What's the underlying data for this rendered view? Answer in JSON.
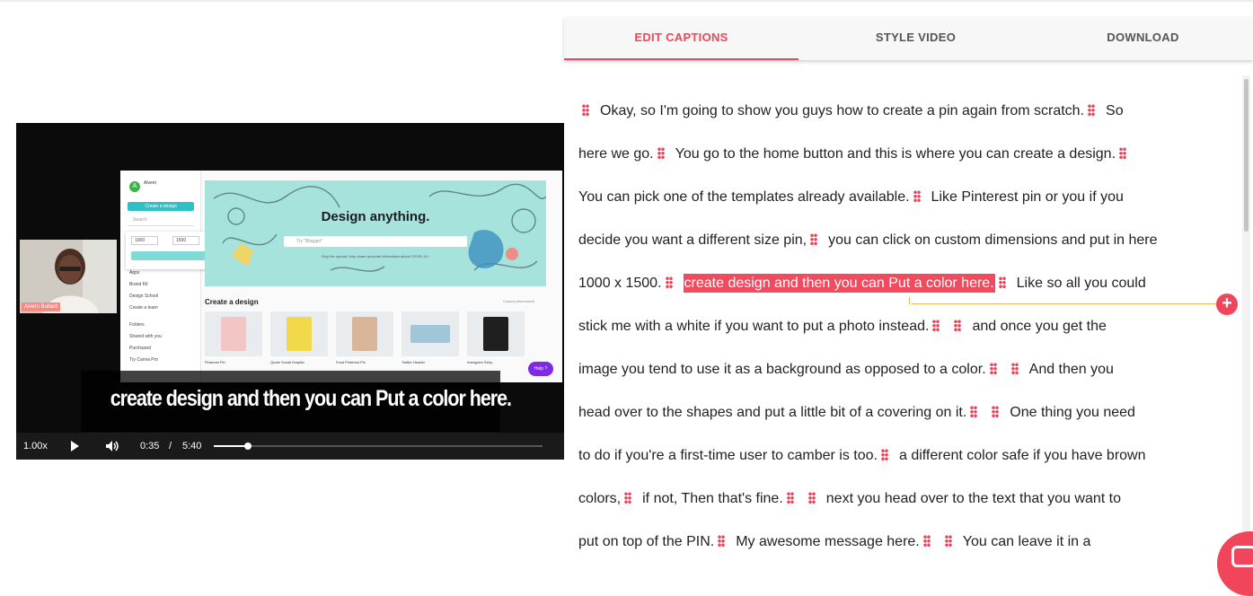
{
  "colors": {
    "accent": "#f0455a",
    "highlight": "#f04b5e",
    "insert_marker": "#f7b45a"
  },
  "tabs": [
    {
      "label": "EDIT CAPTIONS",
      "active": true
    },
    {
      "label": "STYLE VIDEO",
      "active": false
    },
    {
      "label": "DOWNLOAD",
      "active": false
    }
  ],
  "video": {
    "speed": "1.00x",
    "current_time": "0:35",
    "separator": "/",
    "duration": "5:40",
    "progress_fraction": 0.103,
    "caption": "create design and then you can Put a color here.",
    "webcam_name": "Alvern Bullard",
    "canva": {
      "user": "Alvern",
      "create_button": "Create a design",
      "search_placeholder": "Search",
      "width_value": "1000",
      "height_value": "1500",
      "unit": "px",
      "sidebar_items": [
        "Apps",
        "Brand Kit",
        "Design School",
        "Create a team",
        "Folders",
        "Shared with you",
        "Purchased",
        "Try Canva Pro"
      ],
      "banner_title": "Design anything.",
      "banner_search_placeholder": "Try \"Blogger\"",
      "banner_note": "Stop the spread. Help share accurate information about COVID-19 ›",
      "section_title": "Create a design",
      "custom_dimensions": "Custom dimensions",
      "templates": [
        "Pinterest Pin",
        "Quote Social Graphic",
        "Food Pinterest Pin",
        "Twitter Header",
        "Instagram Story"
      ],
      "help_label": "Help ?"
    }
  },
  "captions": [
    [
      {
        "text": "Okay, so I'm going to show you guys how to create a pin again from scratch."
      },
      {
        "text": "So"
      }
    ],
    [
      {
        "text": "here we go."
      },
      {
        "text": "You go to the home button and this is where you can create a design."
      },
      {
        "text": ""
      }
    ],
    [
      {
        "text": "You can pick one of the templates already available."
      },
      {
        "text": "Like Pinterest pin or you if you"
      }
    ],
    [
      {
        "text": "decide you want a different size pin,"
      },
      {
        "text": "you can click on custom dimensions and put in here"
      }
    ],
    [
      {
        "text": "1000 x 1500."
      },
      {
        "text": "create design and then you can Put a color here.",
        "highlighted": true
      },
      {
        "text": "Like so all you could"
      }
    ],
    [
      {
        "text": "stick me with a white if you want to put a photo instead."
      },
      {
        "text": ""
      },
      {
        "text": "and once you get the"
      }
    ],
    [
      {
        "text": "image you tend to use it as a background as opposed to a color."
      },
      {
        "text": ""
      },
      {
        "text": "And then you"
      }
    ],
    [
      {
        "text": "head over to the shapes and put a little bit of a covering on it."
      },
      {
        "text": ""
      },
      {
        "text": "One thing you need"
      }
    ],
    [
      {
        "text": "to do if you're a first-time user to camber is too."
      },
      {
        "text": "a different color safe if you have brown"
      }
    ],
    [
      {
        "text": "colors,"
      },
      {
        "text": "if not, Then that's fine."
      },
      {
        "text": ""
      },
      {
        "text": "next you head over to the text that you want to"
      }
    ],
    [
      {
        "text": "put on top of the PIN."
      },
      {
        "text": "My awesome message here."
      },
      {
        "text": ""
      },
      {
        "text": "You can leave it in a"
      }
    ]
  ],
  "icons": {
    "play": "play-icon",
    "volume": "volume-icon",
    "grip": "drag-handle-icon",
    "add": "plus-icon",
    "chat": "chat-icon"
  }
}
